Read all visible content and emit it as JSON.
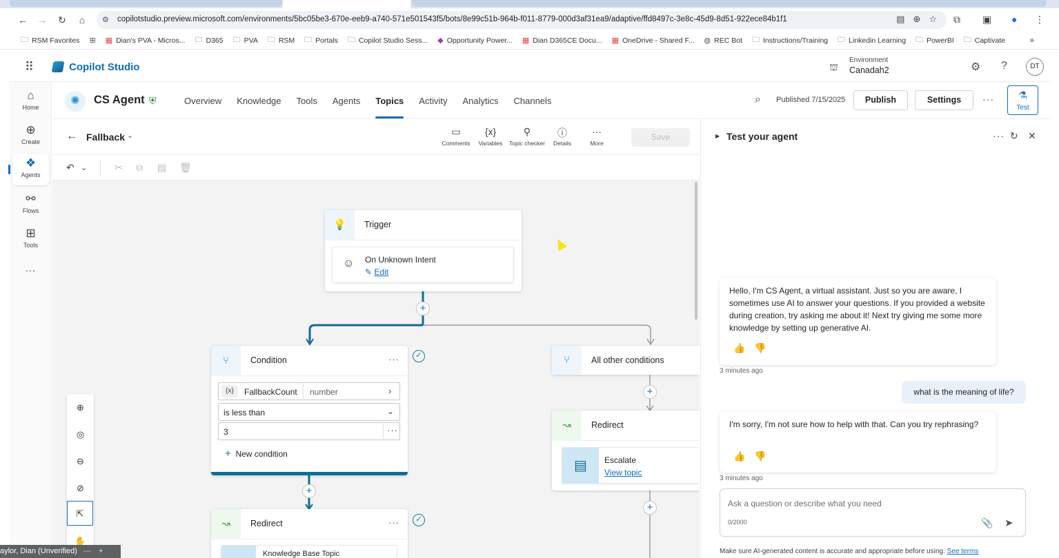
{
  "browser": {
    "url": "copilotstudio.preview.microsoft.com/environments/5bc05be3-670e-eeb9-a740-571e501543f5/bots/8e99c51b-964b-f011-8779-000d3af31ea9/adaptive/ffd8497c-3e8c-45d9-8d51-922ece84b1f1",
    "bookmarks": [
      "RSM Favorites",
      "Dian's PVA - Micros...",
      "D365",
      "PVA",
      "RSM",
      "Portals",
      "Copilot Studio Sess...",
      "Opportunity Power...",
      "Dian D365CE Docu...",
      "OneDrive - Shared F...",
      "REC Bot",
      "Instructions/Training",
      "Linkedin Learning",
      "PowerBI",
      "Captivate"
    ]
  },
  "app": {
    "brand": "Copilot Studio",
    "environment_label": "Environment",
    "environment_value": "Canadah2",
    "avatar_initials": "DT"
  },
  "rail": {
    "items": [
      "Home",
      "Create",
      "Agents",
      "Flows",
      "Tools"
    ],
    "more": "..."
  },
  "agent": {
    "name": "CS Agent",
    "tabs": [
      "Overview",
      "Knowledge",
      "Tools",
      "Agents",
      "Topics",
      "Activity",
      "Analytics",
      "Channels"
    ],
    "active_tab": "Topics",
    "published": "Published 7/15/2025",
    "publish_label": "Publish",
    "settings_label": "Settings",
    "test_label": "Test"
  },
  "topic": {
    "name": "Fallback",
    "tools": [
      "Comments",
      "Variables",
      "Topic checker",
      "Details",
      "More"
    ],
    "save_label": "Save"
  },
  "canvas": {
    "trigger": {
      "title": "Trigger",
      "intent": "On Unknown Intent",
      "edit": "Edit"
    },
    "condition": {
      "title": "Condition",
      "variable": "FallbackCount",
      "variable_type": "number",
      "variable_badge": "{x}",
      "operator": "is less than",
      "value": "3",
      "new_condition": "New condition"
    },
    "other": {
      "title": "All other conditions"
    },
    "redirect_right": {
      "title": "Redirect",
      "target": "Escalate",
      "link": "View topic"
    },
    "redirect_left": {
      "title": "Redirect",
      "target": "Knowledge Base Topic"
    }
  },
  "test_panel": {
    "title": "Test your agent",
    "messages": [
      {
        "role": "bot",
        "text": "Hello, I'm CS Agent, a virtual assistant. Just so you are aware, I sometimes use AI to answer your questions. If you provided a website during creation, try asking me about it! Next try giving me some more knowledge by setting up generative AI.",
        "time": "3 minutes ago"
      },
      {
        "role": "user",
        "text": "what is the meaning of life?"
      },
      {
        "role": "bot",
        "text": "I'm sorry, I'm not sure how to help with that. Can you try rephrasing?",
        "time": "3 minutes ago"
      }
    ],
    "input_placeholder": "Ask a question or describe what you need",
    "char_count": "0/2000",
    "disclaimer": "Make sure AI-generated content is accurate and appropriate before using.",
    "see_terms": "See terms"
  },
  "status_tag": "aylor, Dian (Unverified)",
  "colors": {
    "accent": "#0f6cbd",
    "flow_line": "#0e6e93",
    "canvas_bg": "#f3f3f3"
  }
}
